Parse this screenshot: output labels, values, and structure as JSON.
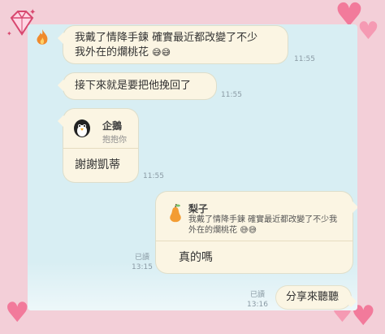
{
  "messages": {
    "m1": {
      "text_line1": "我戴了情降手鍊 確實最近都改變了不少",
      "text_line2": "我外在的爛桃花",
      "emoji": "😅😅",
      "time": "11:55"
    },
    "m2": {
      "text": "接下來就是要把他挽回了",
      "time": "11:55"
    },
    "m3": {
      "reply_name": "企鵝",
      "reply_sub": "抱抱你",
      "text": "謝謝凱蒂",
      "time": "11:55"
    },
    "m4": {
      "reply_name": "梨子",
      "reply_text_line1": "我戴了情降手鍊 確實最近都改變了不少我",
      "reply_text_line2": "外在的爛桃花",
      "emoji": "😅😅",
      "text": "真的嗎",
      "read": "已讀",
      "time": "13:15"
    },
    "m5": {
      "text": "分享來聽聽",
      "read": "已讀",
      "time": "13:16"
    }
  },
  "colors": {
    "frame": "#f3cfd8",
    "chat_bg": "#d8eef3",
    "bubble": "#fbf5e3",
    "heart": "#f27a9b"
  },
  "decor": {
    "heart_icon": "heart-icon",
    "diamond_icon": "diamond-icon",
    "penguin_icon": "penguin-icon",
    "pear_icon": "pear-icon",
    "fire_icon": "fire-icon"
  }
}
